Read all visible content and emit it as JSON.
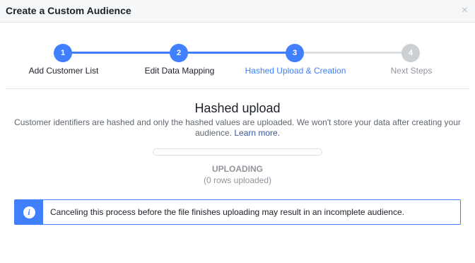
{
  "dialog": {
    "title": "Create a Custom Audience",
    "close_glyph": "×"
  },
  "stepper": {
    "steps": [
      {
        "number": "1",
        "label": "Add Customer List",
        "state": "complete"
      },
      {
        "number": "2",
        "label": "Edit Data Mapping",
        "state": "complete"
      },
      {
        "number": "3",
        "label": "Hashed Upload & Creation",
        "state": "active"
      },
      {
        "number": "4",
        "label": "Next Steps",
        "state": "pending"
      }
    ],
    "colors": {
      "complete": "#4080ff",
      "active": "#4080ff",
      "pending": "#ccd0d5",
      "line_complete": "#4080ff",
      "line_pending": "#dddfe2",
      "label_active": "#4080ff",
      "label_default": "#1d2129",
      "label_pending": "#90949c"
    }
  },
  "content": {
    "title": "Hashed upload",
    "description": "Customer identifiers are hashed and only the hashed values are uploaded. We won't store your data after creating your audience.",
    "learn_more": "Learn more."
  },
  "progress": {
    "fraction": 0.0,
    "status": "UPLOADING",
    "count_text": "(0 rows uploaded)"
  },
  "notice": {
    "icon": "info-icon",
    "icon_glyph": "i",
    "text": "Canceling this process before the file finishes uploading may result in an incomplete audience."
  }
}
